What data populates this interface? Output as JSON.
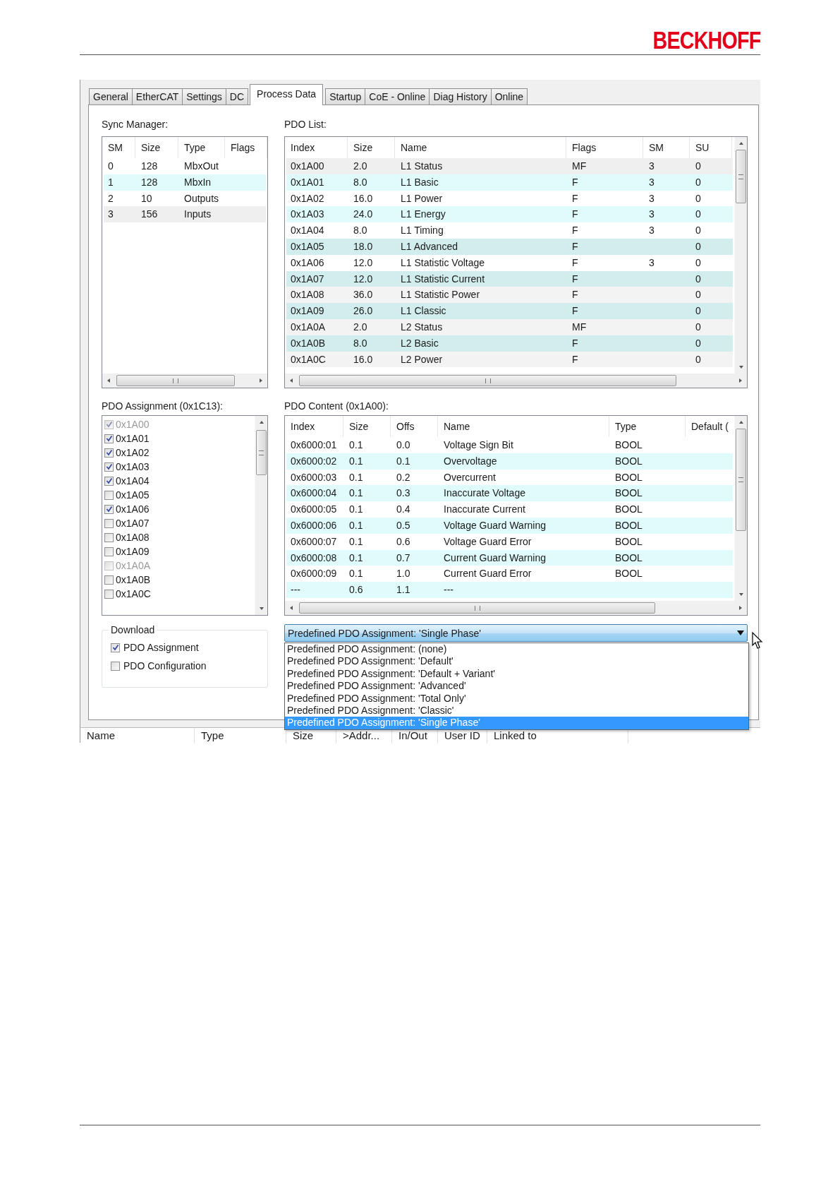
{
  "logo": "BECKHOFF",
  "tabs": [
    {
      "label": "General",
      "selected": false
    },
    {
      "label": "EtherCAT",
      "selected": false
    },
    {
      "label": "Settings",
      "selected": false
    },
    {
      "label": "DC",
      "selected": false
    },
    {
      "label": "Process Data",
      "selected": true
    },
    {
      "label": "Startup",
      "selected": false
    },
    {
      "label": "CoE - Online",
      "selected": false
    },
    {
      "label": "Diag History",
      "selected": false
    },
    {
      "label": "Online",
      "selected": false
    }
  ],
  "sync_manager": {
    "label": "Sync Manager:",
    "columns": [
      "SM",
      "Size",
      "Type",
      "Flags"
    ],
    "rows": [
      {
        "sm": "0",
        "size": "128",
        "type": "MbxOut",
        "color": "#ffffff"
      },
      {
        "sm": "1",
        "size": "128",
        "type": "MbxIn",
        "color": "#e0fbfb"
      },
      {
        "sm": "2",
        "size": "10",
        "type": "Outputs",
        "color": "#ffffff"
      },
      {
        "sm": "3",
        "size": "156",
        "type": "Inputs",
        "color": "#efefef"
      }
    ]
  },
  "pdo_list": {
    "label": "PDO List:",
    "columns": [
      "Index",
      "Size",
      "Name",
      "Flags",
      "SM",
      "SU"
    ],
    "rows": [
      {
        "index": "0x1A00",
        "size": "2.0",
        "name": "L1 Status",
        "flags": "MF",
        "sm": "3",
        "su": "0",
        "color": "#efefef"
      },
      {
        "index": "0x1A01",
        "size": "8.0",
        "name": "L1 Basic",
        "flags": "F",
        "sm": "3",
        "su": "0",
        "color": "#e0fbfb"
      },
      {
        "index": "0x1A02",
        "size": "16.0",
        "name": "L1 Power",
        "flags": "F",
        "sm": "3",
        "su": "0",
        "color": "#ffffff"
      },
      {
        "index": "0x1A03",
        "size": "24.0",
        "name": "L1 Energy",
        "flags": "F",
        "sm": "3",
        "su": "0",
        "color": "#e0fbfb"
      },
      {
        "index": "0x1A04",
        "size": "8.0",
        "name": "L1 Timing",
        "flags": "F",
        "sm": "3",
        "su": "0",
        "color": "#ffffff"
      },
      {
        "index": "0x1A05",
        "size": "18.0",
        "name": "L1 Advanced",
        "flags": "F",
        "su": "0",
        "color": "#d2eded"
      },
      {
        "index": "0x1A06",
        "size": "12.0",
        "name": "L1 Statistic Voltage",
        "flags": "F",
        "sm": "3",
        "su": "0",
        "color": "#ffffff"
      },
      {
        "index": "0x1A07",
        "size": "12.0",
        "name": "L1 Statistic Current",
        "flags": "F",
        "su": "0",
        "color": "#d2eded"
      },
      {
        "index": "0x1A08",
        "size": "36.0",
        "name": "L1 Statistic Power",
        "flags": "F",
        "su": "0",
        "color": "#f3f3f3"
      },
      {
        "index": "0x1A09",
        "size": "26.0",
        "name": "L1 Classic",
        "flags": "F",
        "su": "0",
        "color": "#d2eded"
      },
      {
        "index": "0x1A0A",
        "size": "2.0",
        "name": "L2 Status",
        "flags": "MF",
        "su": "0",
        "color": "#f3f3f3"
      },
      {
        "index": "0x1A0B",
        "size": "8.0",
        "name": "L2 Basic",
        "flags": "F",
        "su": "0",
        "color": "#d2eded"
      },
      {
        "index": "0x1A0C",
        "size": "16.0",
        "name": "L2 Power",
        "flags": "F",
        "su": "0",
        "color": "#f3f3f3"
      }
    ]
  },
  "pdo_assignment": {
    "label": "PDO Assignment (0x1C13):",
    "items": [
      {
        "label": "0x1A00",
        "checked": true,
        "disabled": true
      },
      {
        "label": "0x1A01",
        "checked": true,
        "disabled": false
      },
      {
        "label": "0x1A02",
        "checked": true,
        "disabled": false
      },
      {
        "label": "0x1A03",
        "checked": true,
        "disabled": false
      },
      {
        "label": "0x1A04",
        "checked": true,
        "disabled": false
      },
      {
        "label": "0x1A05",
        "checked": false,
        "disabled": false
      },
      {
        "label": "0x1A06",
        "checked": true,
        "disabled": false
      },
      {
        "label": "0x1A07",
        "checked": false,
        "disabled": false
      },
      {
        "label": "0x1A08",
        "checked": false,
        "disabled": false
      },
      {
        "label": "0x1A09",
        "checked": false,
        "disabled": false
      },
      {
        "label": "0x1A0A",
        "checked": false,
        "disabled": true
      },
      {
        "label": "0x1A0B",
        "checked": false,
        "disabled": false
      },
      {
        "label": "0x1A0C",
        "checked": false,
        "disabled": false
      }
    ]
  },
  "pdo_content": {
    "label": "PDO Content (0x1A00):",
    "columns": [
      "Index",
      "Size",
      "Offs",
      "Name",
      "Type",
      "Default ("
    ],
    "rows": [
      {
        "index": "0x6000:01",
        "size": "0.1",
        "offs": "0.0",
        "name": "Voltage Sign Bit",
        "type": "BOOL",
        "color": "#ffffff"
      },
      {
        "index": "0x6000:02",
        "size": "0.1",
        "offs": "0.1",
        "name": "Overvoltage",
        "type": "BOOL",
        "color": "#e0fbfb"
      },
      {
        "index": "0x6000:03",
        "size": "0.1",
        "offs": "0.2",
        "name": "Overcurrent",
        "type": "BOOL",
        "color": "#ffffff"
      },
      {
        "index": "0x6000:04",
        "size": "0.1",
        "offs": "0.3",
        "name": "Inaccurate Voltage",
        "type": "BOOL",
        "color": "#e0fbfb"
      },
      {
        "index": "0x6000:05",
        "size": "0.1",
        "offs": "0.4",
        "name": "Inaccurate Current",
        "type": "BOOL",
        "color": "#ffffff"
      },
      {
        "index": "0x6000:06",
        "size": "0.1",
        "offs": "0.5",
        "name": "Voltage Guard Warning",
        "type": "BOOL",
        "color": "#e0fbfb"
      },
      {
        "index": "0x6000:07",
        "size": "0.1",
        "offs": "0.6",
        "name": "Voltage Guard Error",
        "type": "BOOL",
        "color": "#ffffff"
      },
      {
        "index": "0x6000:08",
        "size": "0.1",
        "offs": "0.7",
        "name": "Current Guard Warning",
        "type": "BOOL",
        "color": "#e0fbfb"
      },
      {
        "index": "0x6000:09",
        "size": "0.1",
        "offs": "1.0",
        "name": "Current Guard Error",
        "type": "BOOL",
        "color": "#ffffff"
      },
      {
        "index": "---",
        "size": "0.6",
        "offs": "1.1",
        "name": "---",
        "color": "#e0fbfb"
      }
    ]
  },
  "download": {
    "label": "Download",
    "options": [
      {
        "label": "PDO Assignment",
        "checked": true
      },
      {
        "label": "PDO Configuration",
        "checked": false
      }
    ]
  },
  "predefined": {
    "value": "Predefined PDO Assignment: 'Single Phase'",
    "expanded": true,
    "options": [
      {
        "label": "Predefined PDO Assignment: (none)",
        "selected": false
      },
      {
        "label": "Predefined PDO Assignment: 'Default'",
        "selected": false
      },
      {
        "label": "Predefined PDO Assignment: 'Default + Variant'",
        "selected": false
      },
      {
        "label": "Predefined PDO Assignment: 'Advanced'",
        "selected": false
      },
      {
        "label": "Predefined PDO Assignment: 'Total Only'",
        "selected": false
      },
      {
        "label": "Predefined PDO Assignment: 'Classic'",
        "selected": false
      },
      {
        "label": "Predefined PDO Assignment: 'Single Phase'",
        "selected": true
      }
    ]
  },
  "variables": {
    "columns": [
      "Name",
      "Type",
      "Size",
      ">Addr...",
      "In/Out",
      "User ID",
      "Linked to"
    ]
  }
}
